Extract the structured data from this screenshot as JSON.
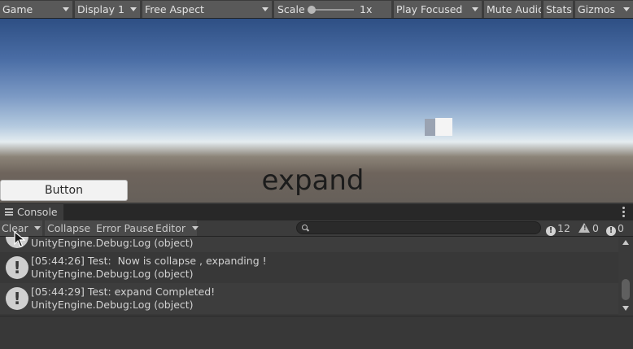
{
  "game_toolbar": {
    "view": "Game",
    "display": "Display 1",
    "aspect": "Free Aspect",
    "scale_label": "Scale",
    "scale_value": "1x",
    "play_mode": "Play Focused",
    "mute_audio": "Mute Audio",
    "stats": "Stats",
    "gizmos": "Gizmos"
  },
  "game_view": {
    "button_label": "Button",
    "display_text": "expand"
  },
  "console": {
    "tab_title": "Console",
    "toolbar": {
      "clear": "Clear",
      "collapse": "Collapse",
      "error_pause": "Error Pause",
      "editor": "Editor",
      "search_placeholder": "",
      "log_count": "12",
      "warning_count": "0",
      "error_count": "0"
    },
    "messages": [
      {
        "line1": "",
        "line2": "UnityEngine.Debug:Log (object)"
      },
      {
        "line1": "[05:44:26] Test:  Now is collapse , expanding !",
        "line2": "UnityEngine.Debug:Log (object)"
      },
      {
        "line1": "[05:44:29] Test: expand Completed!",
        "line2": "UnityEngine.Debug:Log (object)"
      }
    ]
  },
  "colors": {
    "toolbar_bg": "#3c3c3c",
    "button_bg": "#595959",
    "console_bg": "#383838",
    "text": "#c4c4c4"
  }
}
